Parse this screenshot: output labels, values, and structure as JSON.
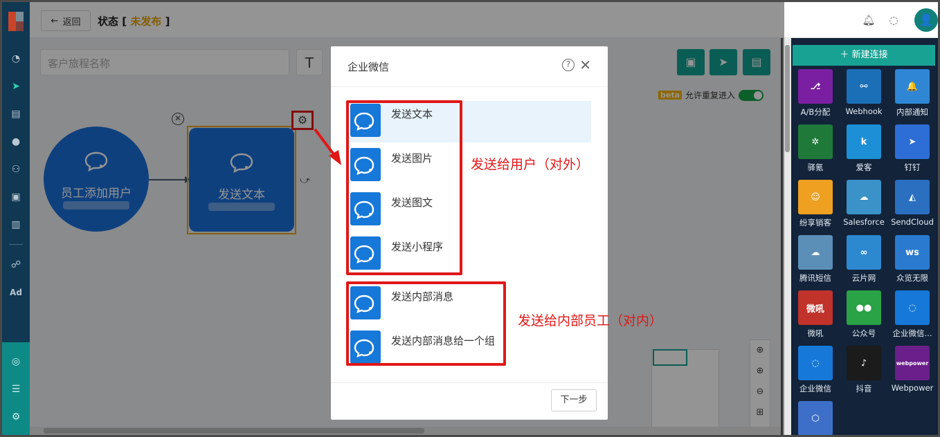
{
  "topbar": {
    "back_label": "返回",
    "status_prefix": "状态",
    "status_open": "[",
    "status_value": "未发布",
    "status_close": "]",
    "avatar_glyph": "👤"
  },
  "canvas": {
    "journey_name_placeholder": "客户旅程名称",
    "text_tool": "T",
    "beta": "beta",
    "reentry_label": "允许重复进入",
    "reentry_enabled": true,
    "start_node_label": "员工添加用户",
    "send_node_label": "发送文本"
  },
  "modal": {
    "title": "企业微信",
    "help": "?",
    "close": "✕",
    "external_options": [
      "发送文本",
      "发送图片",
      "发送图文",
      "发送小程序"
    ],
    "internal_options": [
      "发送内部消息",
      "发送内部消息给一个组"
    ],
    "next_label": "下一步"
  },
  "annotations": {
    "external": "发送给用户（对外）",
    "internal": "发送给内部员工（对内）"
  },
  "right_panel": {
    "new_connection": "新建连接",
    "tiles": [
      {
        "label": "A/B分配",
        "color": "#7a1fa2",
        "glyph": "⎇"
      },
      {
        "label": "Webhook",
        "color": "#1b6fb6",
        "glyph": "⚯"
      },
      {
        "label": "内部通知",
        "color": "#2f86d4",
        "glyph": "🔔"
      },
      {
        "label": "驿氪",
        "color": "#1f7a3a",
        "glyph": "✲"
      },
      {
        "label": "爱客",
        "color": "#1d8fd6",
        "glyph": "k"
      },
      {
        "label": "钉钉",
        "color": "#2d6ed6",
        "glyph": "➤"
      },
      {
        "label": "纷享销客",
        "color": "#f0a020",
        "glyph": "☺"
      },
      {
        "label": "Salesforce",
        "color": "#3b92c9",
        "glyph": "☁"
      },
      {
        "label": "SendCloud",
        "color": "#2a6fc0",
        "glyph": "◭"
      },
      {
        "label": "腾讯短信",
        "color": "#5c8fb8",
        "glyph": "☁"
      },
      {
        "label": "云片网",
        "color": "#2c88cf",
        "glyph": "∞"
      },
      {
        "label": "众览无限",
        "color": "#2a7bd0",
        "glyph": "ws"
      },
      {
        "label": "微吼",
        "color": "#c0322a",
        "glyph": "微吼"
      },
      {
        "label": "公众号",
        "color": "#2aa246",
        "glyph": "●●"
      },
      {
        "label": "企业微信...",
        "color": "#1678d8",
        "glyph": "◌"
      },
      {
        "label": "企业微信",
        "color": "#1678d8",
        "glyph": "◌"
      },
      {
        "label": "抖音",
        "color": "#1b1b1b",
        "glyph": "♪"
      },
      {
        "label": "Webpower",
        "color": "#6a1f8a",
        "glyph": "webpower"
      },
      {
        "label": "",
        "color": "#3d6fc9",
        "glyph": "⬡"
      }
    ]
  }
}
